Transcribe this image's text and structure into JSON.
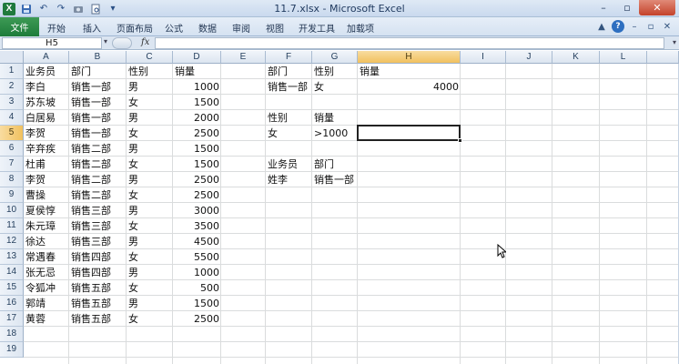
{
  "window": {
    "title": "11.7.xlsx - Microsoft Excel",
    "quick_access": [
      "excel-logo-icon",
      "save-icon",
      "undo-icon",
      "redo-icon",
      "camera-icon",
      "print-preview-icon",
      "customize-dropdown-icon"
    ],
    "controls": {
      "minimize": "–",
      "restore": "▫",
      "close": "✕"
    }
  },
  "ribbon": {
    "file_tab": "文件",
    "tabs": [
      "开始",
      "插入",
      "页面布局",
      "公式",
      "数据",
      "审阅",
      "视图",
      "开发工具",
      "加载项"
    ]
  },
  "formula_bar": {
    "name_box": "H5",
    "fx": "fx",
    "value": ""
  },
  "sheet": {
    "columns": [
      "A",
      "B",
      "C",
      "D",
      "E",
      "F",
      "G",
      "H",
      "I",
      "J",
      "K",
      "L"
    ],
    "rows": [
      "1",
      "2",
      "3",
      "4",
      "5",
      "6",
      "7",
      "8",
      "9",
      "10",
      "11",
      "12",
      "13",
      "14",
      "15",
      "16",
      "17",
      "18",
      "19"
    ],
    "selected_column": "H",
    "selected_row": "5",
    "cells": {
      "A1": "业务员",
      "B1": "部门",
      "C1": "性别",
      "D1": "销量",
      "A2": "李白",
      "B2": "销售一部",
      "C2": "男",
      "D2": "1000",
      "A3": "苏东坡",
      "B3": "销售一部",
      "C3": "女",
      "D3": "1500",
      "A4": "白居易",
      "B4": "销售一部",
      "C4": "男",
      "D4": "2000",
      "A5": "李贺",
      "B5": "销售一部",
      "C5": "女",
      "D5": "2500",
      "A6": "辛弃疾",
      "B6": "销售二部",
      "C6": "男",
      "D6": "1500",
      "A7": "杜甫",
      "B7": "销售二部",
      "C7": "女",
      "D7": "1500",
      "A8": "李贺",
      "B8": "销售二部",
      "C8": "男",
      "D8": "2500",
      "A9": "曹操",
      "B9": "销售二部",
      "C9": "女",
      "D9": "2500",
      "A10": "夏侯惇",
      "B10": "销售三部",
      "C10": "男",
      "D10": "3000",
      "A11": "朱元璋",
      "B11": "销售三部",
      "C11": "女",
      "D11": "3500",
      "A12": "徐达",
      "B12": "销售三部",
      "C12": "男",
      "D12": "4500",
      "A13": "常遇春",
      "B13": "销售四部",
      "C13": "女",
      "D13": "5500",
      "A14": "张无忌",
      "B14": "销售四部",
      "C14": "男",
      "D14": "1000",
      "A15": "令狐冲",
      "B15": "销售五部",
      "C15": "女",
      "D15": "500",
      "A16": "郭靖",
      "B16": "销售五部",
      "C16": "男",
      "D16": "1500",
      "A17": "黄蓉",
      "B17": "销售五部",
      "C17": "女",
      "D17": "2500",
      "F1": "部门",
      "G1": "性别",
      "H1": "销量",
      "F2": "销售一部",
      "G2": "女",
      "H2": "4000",
      "F4": "性别",
      "G4": "销量",
      "F5": "女",
      "G5": ">1000",
      "F7": "业务员",
      "G7": "部门",
      "F8": "姓李",
      "G8": "销售一部"
    },
    "numeric_cells": [
      "D2",
      "D3",
      "D4",
      "D5",
      "D6",
      "D7",
      "D8",
      "D9",
      "D10",
      "D11",
      "D12",
      "D13",
      "D14",
      "D15",
      "D16",
      "D17",
      "H2"
    ],
    "active_cell": "H5"
  },
  "colors": {
    "file_tab": "#1e7c3a",
    "header_selected": "#f1c15f",
    "gridline": "#dadcdd",
    "ribbon_bg": "#d5e2f1"
  }
}
